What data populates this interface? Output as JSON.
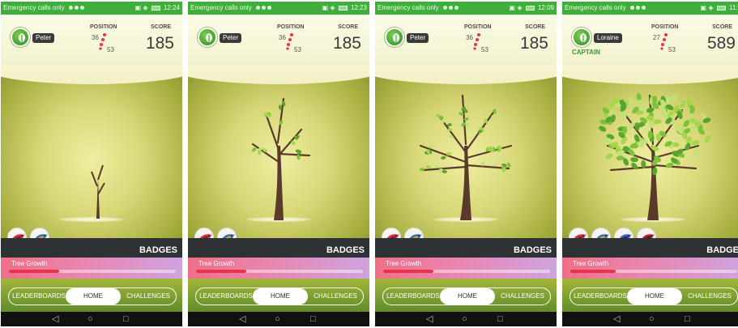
{
  "screens": [
    {
      "status": {
        "carrier": "Emergency calls only",
        "time": "12:24"
      },
      "player": {
        "name": "Peter",
        "role": ""
      },
      "position": {
        "label": "POSITION",
        "current": "36",
        "total": "53"
      },
      "score": {
        "label": "SCORE",
        "value": "185"
      },
      "tree_stage": 0,
      "badges": [
        "red-bird-badge",
        "blue-bird-badge"
      ],
      "badges_label": "BADGES",
      "growth": {
        "label": "Tree Growth",
        "progress": 0.3
      },
      "nav": {
        "left": "LEADERBOARDS",
        "middle": "HOME",
        "right": "CHALLENGES",
        "active": "HOME"
      },
      "system_nav": [
        "back-icon",
        "home-circle-icon",
        "recents-square-icon"
      ]
    },
    {
      "status": {
        "carrier": "Emergency calls only",
        "time": "12:23"
      },
      "player": {
        "name": "Peter",
        "role": ""
      },
      "position": {
        "label": "POSITION",
        "current": "36",
        "total": "53"
      },
      "score": {
        "label": "SCORE",
        "value": "185"
      },
      "tree_stage": 1,
      "badges": [
        "red-bird-badge",
        "blue-bird-badge"
      ],
      "badges_label": "BADGES",
      "growth": {
        "label": "Tree Growth",
        "progress": 0.3
      },
      "nav": {
        "left": "LEADERBOARDS",
        "middle": "HOME",
        "right": "CHALLENGES",
        "active": "HOME"
      },
      "system_nav": [
        "back-icon",
        "home-circle-icon",
        "recents-square-icon"
      ]
    },
    {
      "status": {
        "carrier": "Emergency calls only",
        "time": "12:09"
      },
      "player": {
        "name": "Peter",
        "role": ""
      },
      "position": {
        "label": "POSITION",
        "current": "36",
        "total": "53"
      },
      "score": {
        "label": "SCORE",
        "value": "185"
      },
      "tree_stage": 2,
      "badges": [
        "red-bird-badge",
        "blue-bird-badge"
      ],
      "badges_label": "BADGES",
      "growth": {
        "label": "Tree Growth",
        "progress": 0.3
      },
      "nav": {
        "left": "LEADERBOARDS",
        "middle": "HOME",
        "right": "CHALLENGES",
        "active": "HOME"
      },
      "system_nav": [
        "back-icon",
        "home-circle-icon",
        "recents-square-icon"
      ]
    },
    {
      "status": {
        "carrier": "Emergency calls only",
        "time": "11:1"
      },
      "player": {
        "name": "Loraine",
        "role": "CAPTAIN"
      },
      "position": {
        "label": "POSITION",
        "current": "27",
        "total": "53"
      },
      "score": {
        "label": "SCORE",
        "value": "589"
      },
      "tree_stage": 3,
      "badges": [
        "red-bird-badge",
        "blue-bird-badge",
        "blue-jay-badge",
        "cardinal-badge"
      ],
      "badges_label": "BADGE",
      "growth": {
        "label": "Tree Growth",
        "progress": 0.27
      },
      "nav": {
        "left": "LEADERBOARDS",
        "middle": "HOME",
        "right": "CHALLENGES",
        "active": "HOME"
      },
      "system_nav": [
        "back-icon",
        "home-circle-icon",
        "recents-square-icon"
      ]
    }
  ],
  "colors": {
    "status": "#3fae3a",
    "progress": "#e8334f",
    "leaf": "#7cc23a",
    "trunk": "#5a3a2a"
  }
}
